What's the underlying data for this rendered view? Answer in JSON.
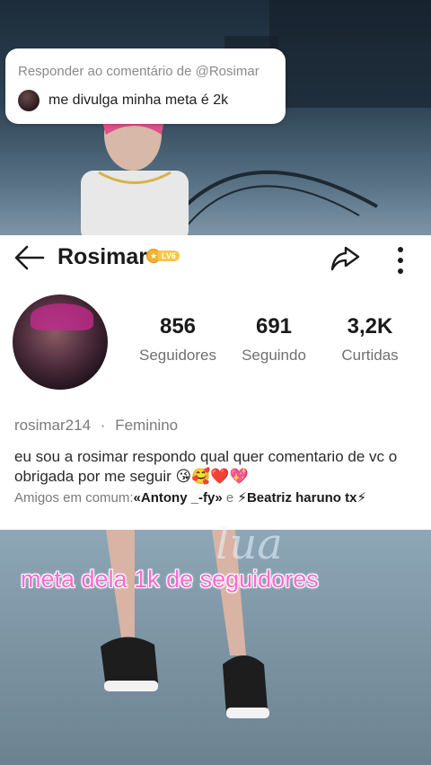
{
  "reply": {
    "header": "Responder ao comentário de @Rosimar",
    "text": "me divulga minha meta é 2k"
  },
  "profile": {
    "name": "Rosimar",
    "level": "LV6",
    "stats": [
      {
        "value": "856",
        "label": "Seguidores"
      },
      {
        "value": "691",
        "label": "Seguindo"
      },
      {
        "value": "3,2K",
        "label": "Curtidas"
      }
    ],
    "handle": "rosimar214",
    "separator": "·",
    "gender": "Feminino",
    "bio": "eu sou a rosimar respondo qual quer comentario de vc o obrigada por me seguir 😘🥰❤️💖",
    "mutual_prefix": "Amigos em comum:",
    "mutual_friend_1": "«Antony _-fy»",
    "mutual_joiner": " e ",
    "mutual_friend_2": "⚡Beatriz  haruno tx⚡"
  },
  "video_overlay": {
    "caption": "meta dela 1k de seguidores",
    "watermark": "lua"
  },
  "icons": {
    "back": "back-arrow-icon",
    "share": "share-icon",
    "more": "more-vertical-icon"
  },
  "colors": {
    "caption_pink": "#ff6ad1",
    "badge_gold": "#f2b233"
  }
}
